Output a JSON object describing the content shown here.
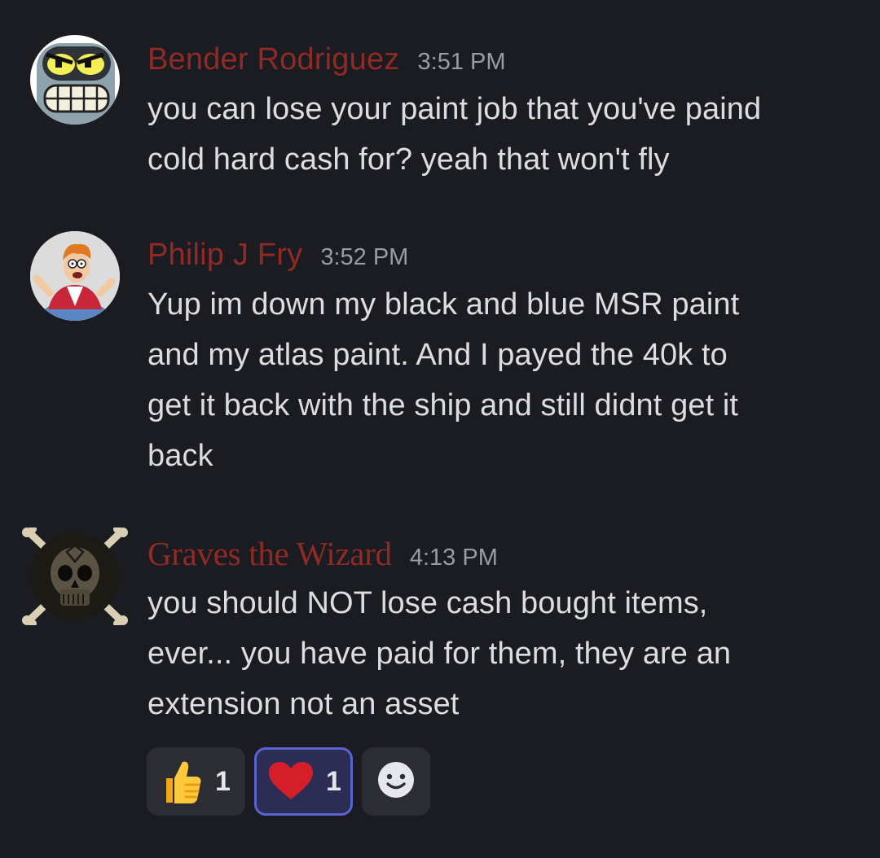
{
  "colors": {
    "background": "#1b1c21",
    "username_red": "#8f2a25",
    "text": "#dcdde2",
    "timestamp": "#9a9ca4",
    "reaction_bg": "#2c2d33",
    "reaction_active_bg": "#2b2d55",
    "reaction_active_border": "#5b63d3"
  },
  "messages": [
    {
      "author": "Bender Rodriguez",
      "time": "3:51 PM",
      "avatar_icon": "bender-robot-avatar",
      "lines": [
        "you can lose your paint job that you've paind",
        "cold hard cash for? yeah that won't fly"
      ]
    },
    {
      "author": "Philip J Fry",
      "time": "3:52 PM",
      "avatar_icon": "fry-cartoon-avatar",
      "lines": [
        "Yup im down my black and blue MSR paint",
        "and my atlas paint. And I payed the 40k to",
        "get it back with the ship and still didnt get it",
        "back"
      ]
    },
    {
      "author": "Graves the Wizard",
      "time": "4:13 PM",
      "avatar_icon": "skull-crossbones-avatar",
      "lines": [
        "you should NOT lose cash bought items,",
        "ever... you have paid for them, they are an",
        "extension not an asset"
      ]
    }
  ],
  "reactions": [
    {
      "emoji": "thumbs-up-icon",
      "count": "1",
      "active": false
    },
    {
      "emoji": "heart-icon",
      "count": "1",
      "active": true
    }
  ],
  "add_reaction_icon": "smiley-face-icon"
}
